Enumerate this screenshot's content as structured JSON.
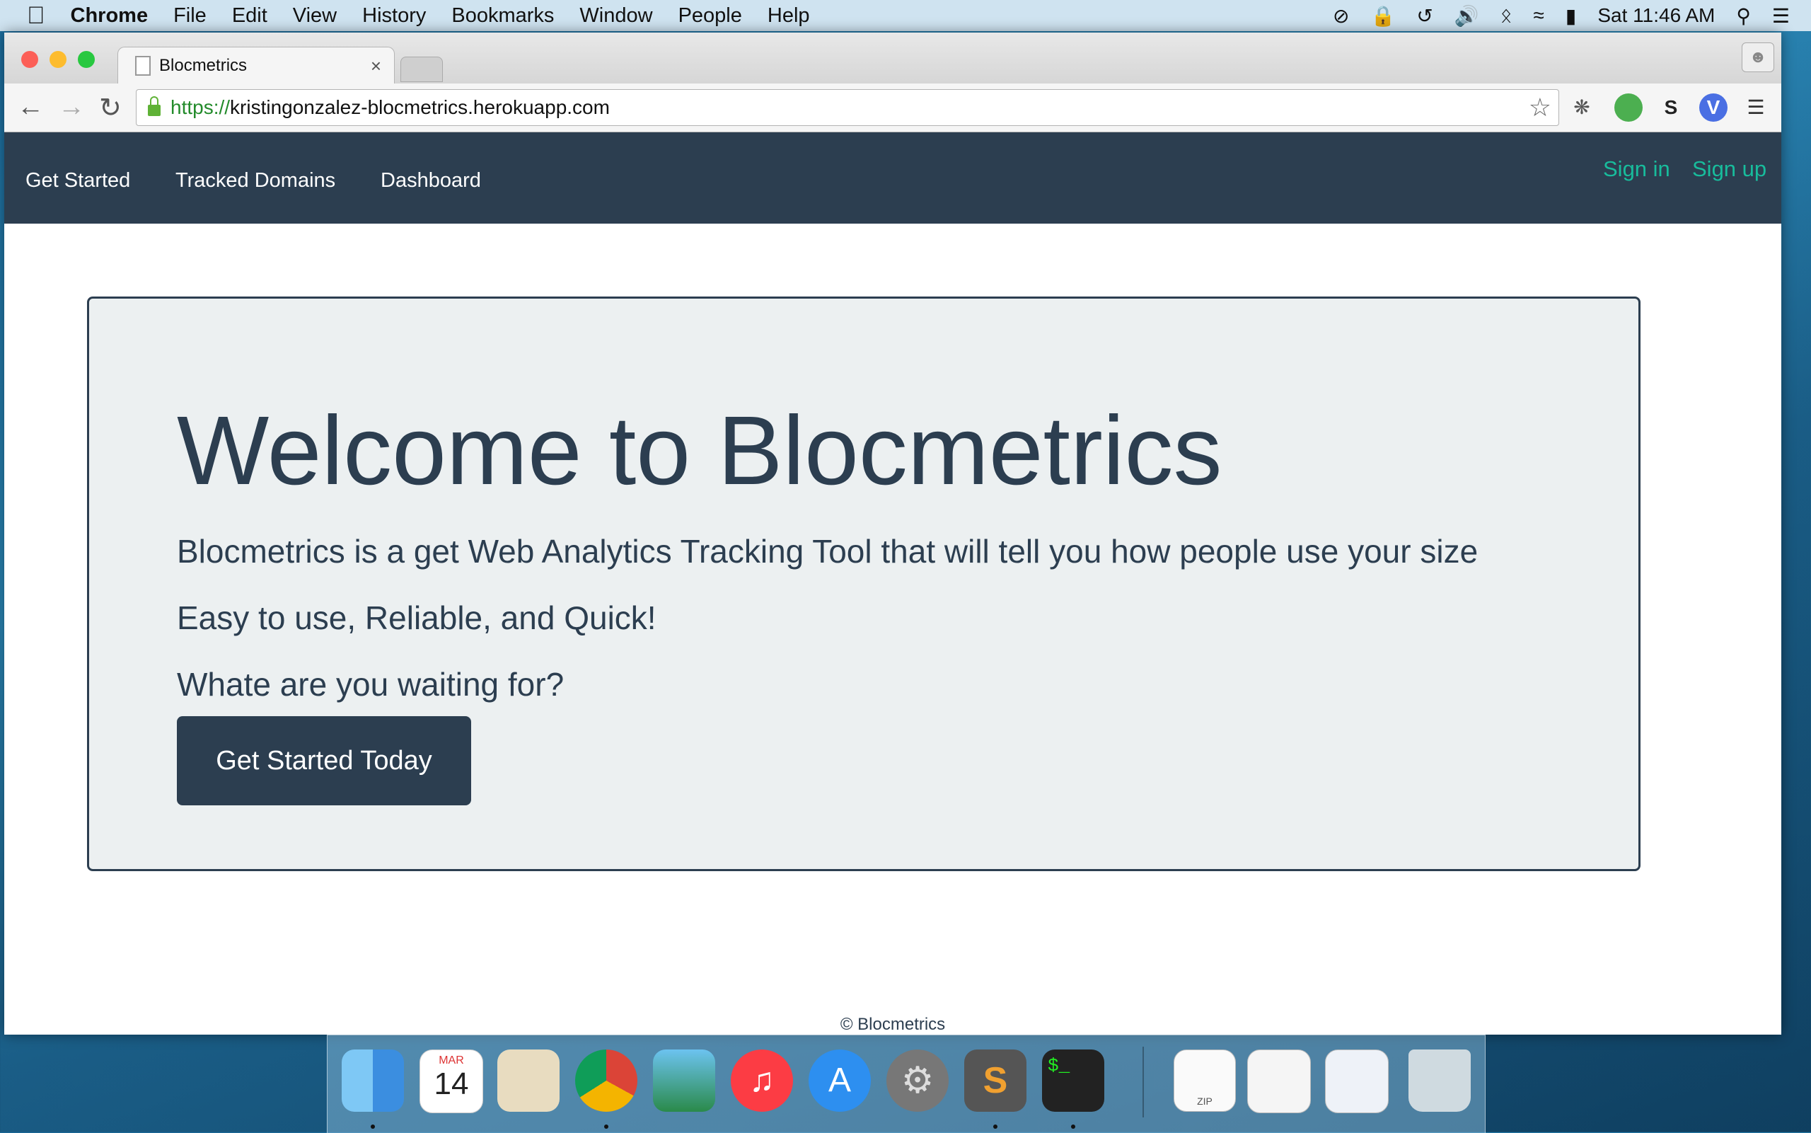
{
  "menubar": {
    "app_name": "Chrome",
    "items": [
      "File",
      "Edit",
      "View",
      "History",
      "Bookmarks",
      "Window",
      "People",
      "Help"
    ],
    "clock": "Sat 11:46 AM"
  },
  "browser": {
    "tab_title": "Blocmetrics",
    "tab_close": "×",
    "url_scheme": "https://",
    "url_host": "kristingonzalez-blocmetrics.herokuapp.com"
  },
  "navbar": {
    "links": [
      "Get Started",
      "Tracked Domains",
      "Dashboard"
    ],
    "sign_in": "Sign in",
    "sign_up": "Sign up"
  },
  "hero": {
    "heading": "Welcome to Blocmetrics",
    "line1": "Blocmetrics is a get Web Analytics Tracking Tool that will tell you how people use your size",
    "line2": "Easy to use, Reliable, and Quick!",
    "line3": "Whate are you waiting for?",
    "cta_label": "Get Started Today"
  },
  "footer": {
    "text": "© Blocmetrics"
  },
  "dock": {
    "calendar_month": "MAR",
    "calendar_day": "14",
    "zip_label": "ZIP"
  },
  "colors": {
    "navbar_bg": "#2c3e50",
    "accent": "#18bc9c",
    "jumbotron_bg": "#ecf0f1"
  }
}
